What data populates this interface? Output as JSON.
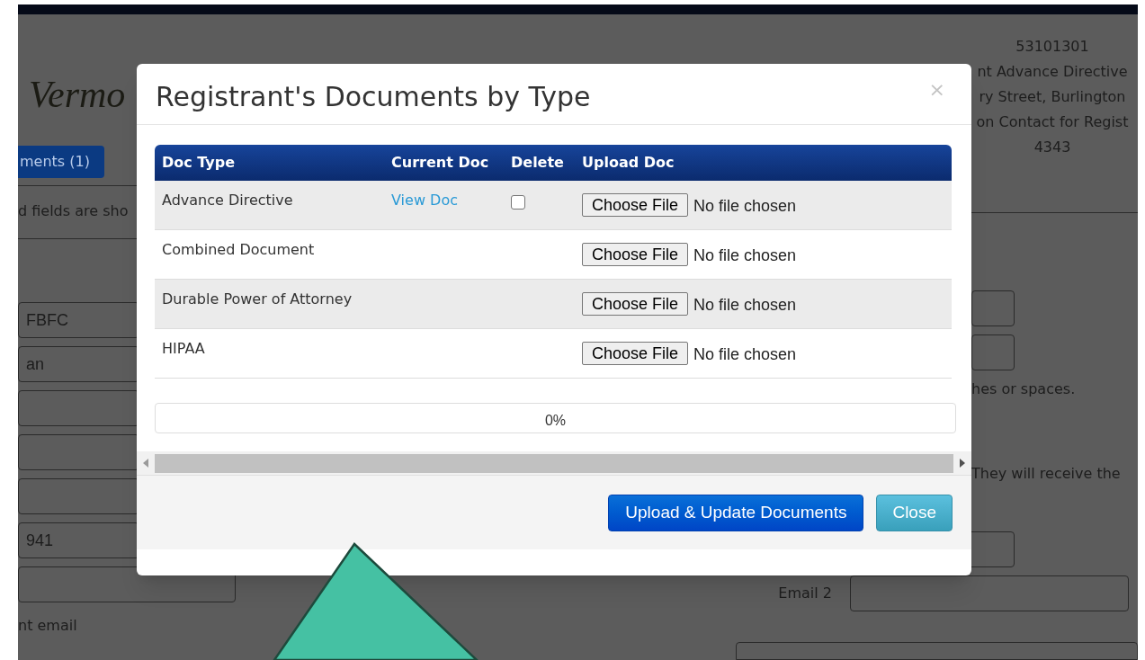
{
  "page": {
    "logo_text": "Vermo",
    "header_info": [
      "53101301",
      "nt Advance Directive",
      "ry Street, Burlington",
      "on Contact for Regist",
      "4343"
    ],
    "tab_button": "ments (1)",
    "required_note": "d fields are sho",
    "left_fields": [
      {
        "value": "FBFC"
      },
      {
        "value": "an"
      },
      {
        "value": "941"
      }
    ],
    "left_note": "nt email",
    "hint_texts": [
      "hes or spaces.",
      "They will receive the"
    ],
    "email_label": "Email 2"
  },
  "modal": {
    "title": "Registrant's Documents by Type",
    "close_symbol": "×",
    "table": {
      "columns": [
        "Doc Type",
        "Current Doc",
        "Delete",
        "Upload Doc"
      ],
      "rows": [
        {
          "doc_type": "Advance Directive",
          "current_doc": "View Doc",
          "delete": {
            "checked": false
          },
          "choose_label": "Choose File",
          "file_status": "No file chosen"
        },
        {
          "doc_type": "Combined Document",
          "choose_label": "Choose File",
          "file_status": "No file chosen"
        },
        {
          "doc_type": "Durable Power of Attorney",
          "choose_label": "Choose File",
          "file_status": "No file chosen"
        },
        {
          "doc_type": "HIPAA",
          "choose_label": "Choose File",
          "file_status": "No file chosen"
        }
      ]
    },
    "progress": {
      "level": 0,
      "label": "0%"
    },
    "buttons": [
      {
        "label": "Upload & Update Documents",
        "kind": "primary"
      },
      {
        "label": "Close",
        "kind": "info"
      }
    ]
  }
}
